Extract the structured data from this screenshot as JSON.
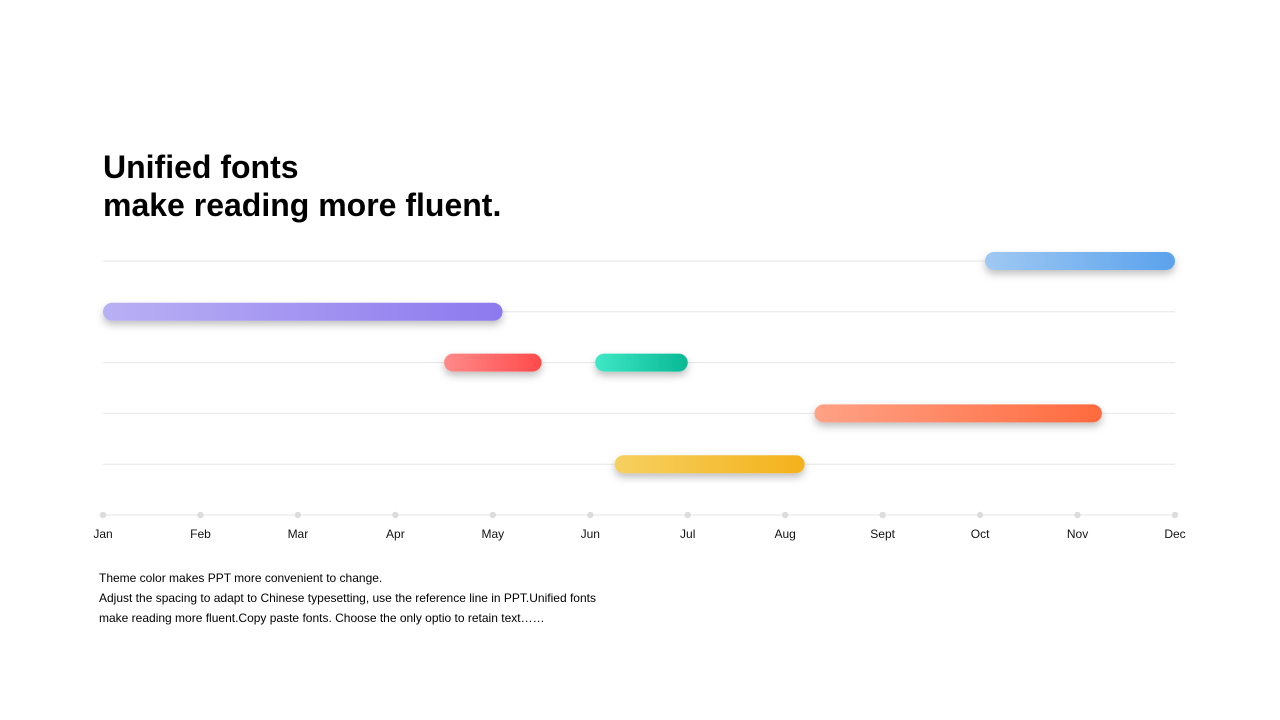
{
  "title": {
    "line1": "Unified fonts",
    "line2": "make reading more fluent."
  },
  "chart_data": {
    "type": "gantt",
    "xlabel": "",
    "ylabel": "",
    "months": [
      "Jan",
      "Feb",
      "Mar",
      "Apr",
      "May",
      "Jun",
      "Jul",
      "Aug",
      "Sept",
      "Oct",
      "Nov",
      "Dec"
    ],
    "xlim": [
      0,
      11
    ],
    "rows": 5,
    "tasks": [
      {
        "row": 0,
        "start": 9.05,
        "end": 11.0,
        "color_start": "#9fc9f3",
        "color_end": "#5aa2ec"
      },
      {
        "row": 1,
        "start": 0.0,
        "end": 4.1,
        "color_start": "#b9b0f4",
        "color_end": "#8d79ee"
      },
      {
        "row": 2,
        "start": 3.5,
        "end": 4.5,
        "color_start": "#ff8a8a",
        "color_end": "#ff4a4a"
      },
      {
        "row": 2,
        "start": 5.05,
        "end": 6.0,
        "color_start": "#3fe8c6",
        "color_end": "#08b894"
      },
      {
        "row": 3,
        "start": 7.3,
        "end": 10.25,
        "color_start": "#ffa286",
        "color_end": "#ff6a3e"
      },
      {
        "row": 4,
        "start": 5.25,
        "end": 7.2,
        "color_start": "#f6d060",
        "color_end": "#f4b21b"
      }
    ],
    "grid": true,
    "legend": "none"
  },
  "description": {
    "line1": "Theme  color makes PPT more convenient to change.",
    "line2": "Adjust the spacing to adapt to Chinese typesetting, use the reference line in PPT.Unified fonts",
    "line3": "make reading more fluent.Copy paste fonts. Choose the only optio to retain text……"
  }
}
